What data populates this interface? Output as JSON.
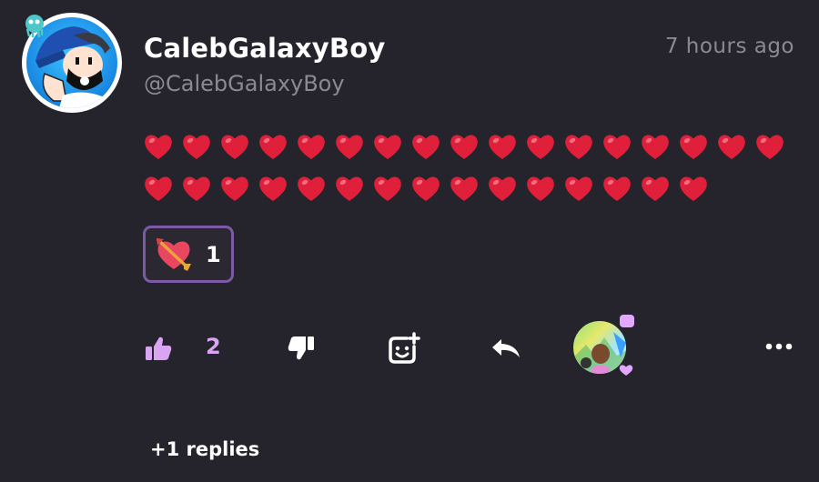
{
  "comment": {
    "username": "CalebGalaxyBoy",
    "handle": "@CalebGalaxyBoy",
    "timestamp": "7 hours ago",
    "hearts_row1": 17,
    "hearts_row2": 15,
    "reaction": {
      "icon": "heart-with-arrow-icon",
      "count": "1"
    },
    "actions": {
      "like_count": "2",
      "like_icon": "thumbs-up-icon",
      "dislike_icon": "thumbs-down-icon",
      "react_icon": "add-reaction-icon",
      "reply_icon": "reply-arrow-icon",
      "more_icon": "more-dots-icon"
    },
    "replies_label": "+1 replies"
  },
  "colors": {
    "background": "#25232b",
    "muted_text": "#8b8a93",
    "heart": "#e0203a",
    "chip_border": "#7c5aa6",
    "accent_pink": "#d9a5f2"
  }
}
